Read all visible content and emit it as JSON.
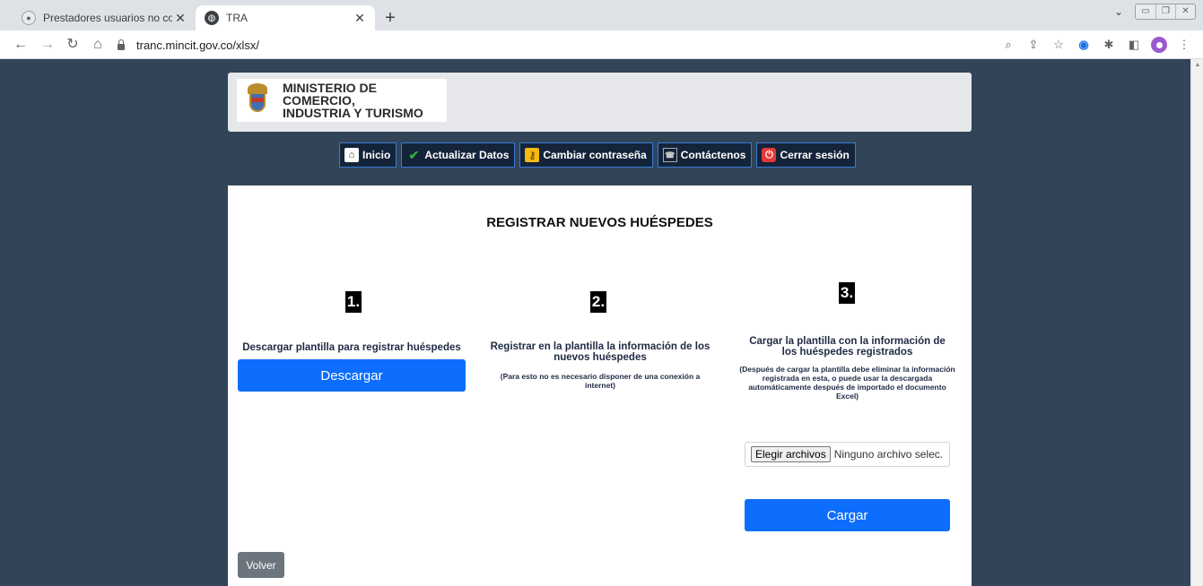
{
  "browser": {
    "tabs": [
      {
        "title": "Prestadores usuarios no conecta",
        "icon": "globe-icon",
        "active": false
      },
      {
        "title": "TRA",
        "icon": "globe-icon",
        "active": true
      }
    ],
    "url": "tranc.mincit.gov.co/xlsx/"
  },
  "header": {
    "ministry_line1": "MINISTERIO DE COMERCIO,",
    "ministry_line2": "INDUSTRIA Y TURISMO"
  },
  "nav": {
    "home": "Inicio",
    "update": "Actualizar Datos",
    "change_password": "Cambiar contraseña",
    "contact": "Contáctenos",
    "logout": "Cerrar sesión"
  },
  "main": {
    "heading": "REGISTRAR NUEVOS HUÉSPEDES",
    "steps": [
      {
        "number": "1.",
        "title": "Descargar plantilla para registrar huéspedes",
        "button": "Descargar"
      },
      {
        "number": "2.",
        "title": "Registrar en la plantilla la información de los nuevos huéspedes",
        "note": "(Para esto no es necesario disponer de una conexión a internet)"
      },
      {
        "number": "3.",
        "title": "Cargar la plantilla con la información de los huéspedes registrados",
        "note": "(Después de cargar la plantilla debe eliminar la información registrada en esta, o puede usar la descargada automáticamente después de importado el documento Excel)",
        "file_button": "Elegir archivos",
        "file_status": "Ninguno archivo selec.",
        "button": "Cargar"
      }
    ],
    "back": "Volver"
  },
  "colors": {
    "page_bg": "#324458",
    "primary": "#0d6efd",
    "secondary": "#6c757d",
    "nav_bg": "#14243a"
  }
}
